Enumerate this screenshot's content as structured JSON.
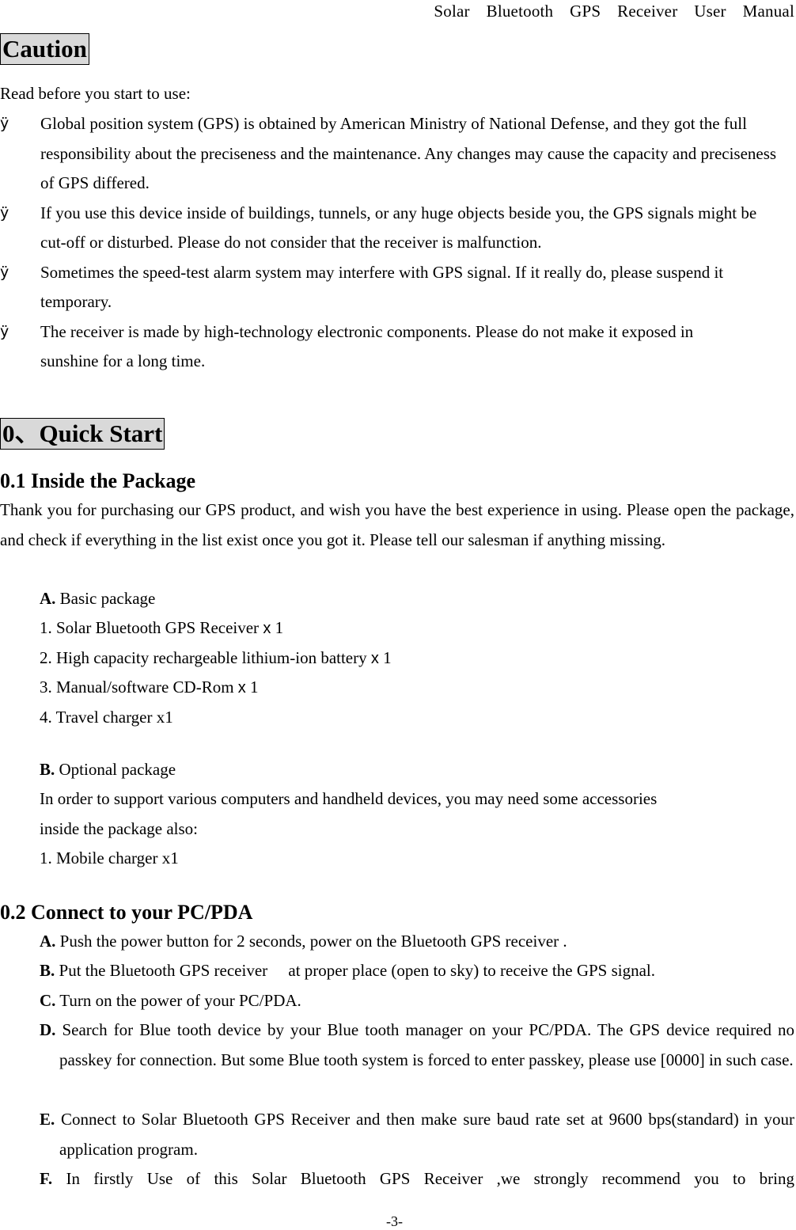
{
  "header": {
    "running_title": "Solar  Bluetooth  GPS  Receiver  User  Manual"
  },
  "caution": {
    "heading": "Caution",
    "intro": "Read before you start to use:",
    "bullet_symbol": "ÿ",
    "bullets": [
      "Global position system (GPS) is obtained by American Ministry of National Defense, and they got the full responsibility about the preciseness and the maintenance. Any changes may cause the capacity and preciseness of GPS differed.",
      "If you use this device inside of buildings, tunnels, or any huge objects beside you, the GPS signals might be cut-off or disturbed. Please do not consider that the receiver is malfunction.",
      "Sometimes the speed-test alarm system may interfere with GPS signal. If it really do, please suspend it temporary.",
      "The receiver is made by high-technology electronic components. Please do not make it exposed in sunshine for a long time."
    ]
  },
  "quick_start": {
    "heading": "0、Quick Start",
    "section_01": {
      "title": "0.1 Inside the Package",
      "intro": "Thank you for purchasing our GPS product, and wish you have the best experience in using. Please open the package, and check if everything in the list exist once you got it. Please tell our salesman if anything missing.",
      "basic": {
        "label": "A.",
        "title": " Basic package",
        "items": [
          {
            "text": "1. Solar Bluetooth GPS Receiver ",
            "qty_symbol": "x",
            "qty": " 1"
          },
          {
            "text": "2. High capacity rechargeable lithium-ion battery ",
            "qty_symbol": "x",
            "qty": " 1"
          },
          {
            "text": "3. Manual/software CD-Rom ",
            "qty_symbol": "x",
            "qty": " 1"
          },
          {
            "text": "4. Travel charger x1",
            "qty_symbol": "",
            "qty": ""
          }
        ]
      },
      "optional": {
        "label": "B.",
        "title": " Optional package",
        "description_line1": "In order to support various computers and handheld devices, you may need some accessories",
        "description_line2": "inside the package also:",
        "items": [
          "1. Mobile charger x1"
        ]
      }
    },
    "section_02": {
      "title": "0.2 Connect to your PC/PDA",
      "steps": [
        {
          "label": "A.",
          "text": " Push the power button for 2 seconds, power on the Bluetooth GPS receiver ."
        },
        {
          "label": "B.",
          "text": " Put the Bluetooth GPS receiver　 at proper place (open to sky) to receive the GPS signal."
        },
        {
          "label": "C.",
          "text": " Turn on the power of your PC/PDA."
        },
        {
          "label": "D.",
          "text": " Search for Blue tooth device by your Blue tooth manager on your PC/PDA. The GPS device required no passkey for connection. But some Blue tooth system is forced to enter passkey, please use [0000] in such case."
        },
        {
          "label": "E.",
          "text": " Connect to Solar Bluetooth GPS Receiver  and then make sure baud rate set at 9600 bps(standard) in your application program."
        },
        {
          "label": "F.",
          "text": " In firstly Use of this Solar Bluetooth GPS Receiver ,we strongly recommend you to bring"
        }
      ]
    }
  },
  "footer": {
    "page_number": "-3-"
  }
}
